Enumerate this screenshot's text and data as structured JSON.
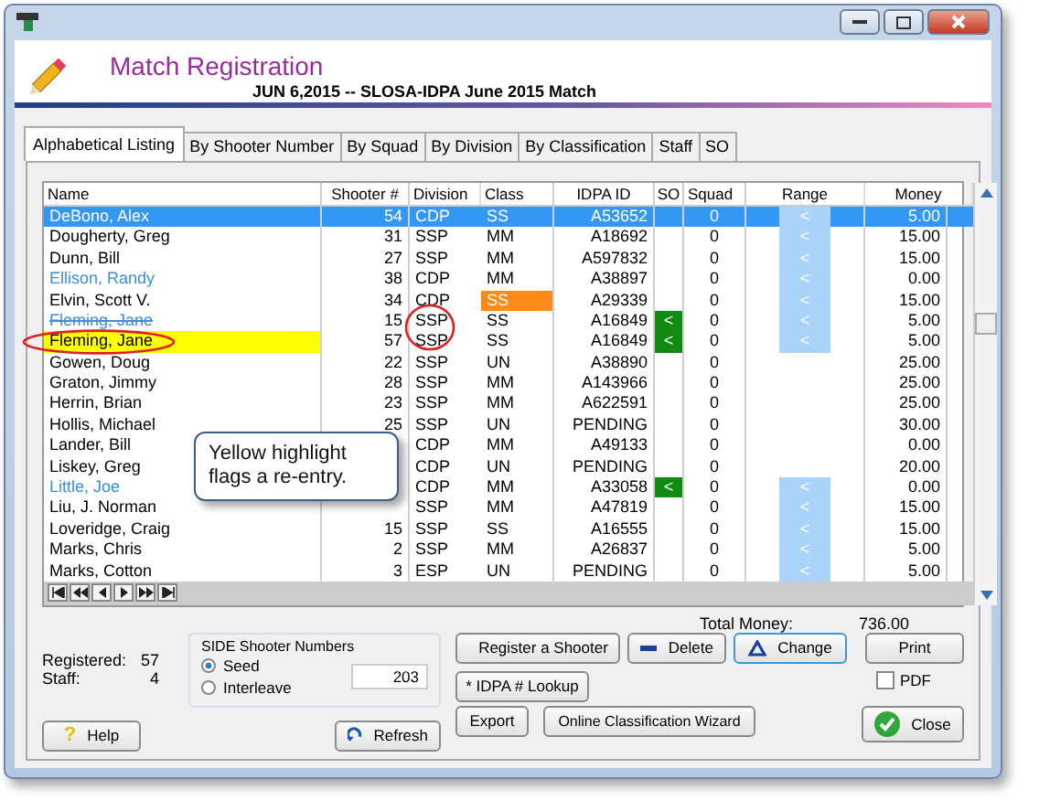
{
  "window": {
    "title": "Match Registration",
    "subtitle": "JUN  6,2015 -- SLOSA-IDPA June 2015 Match"
  },
  "tabs": [
    {
      "label": "Alphabetical Listing",
      "selected": true
    },
    {
      "label": "By Shooter Number",
      "selected": false
    },
    {
      "label": "By Squad",
      "selected": false
    },
    {
      "label": "By Division",
      "selected": false
    },
    {
      "label": "By Classification",
      "selected": false
    },
    {
      "label": "Staff",
      "selected": false
    },
    {
      "label": "SO",
      "selected": false
    }
  ],
  "table": {
    "columns": [
      "Name",
      "Shooter #",
      "Division",
      "Class",
      "IDPA ID",
      "SO",
      "Squad",
      "Range",
      "Money"
    ],
    "rows": [
      {
        "name": "DeBono, Alex",
        "number": "54",
        "division": "CDP",
        "class": "SS",
        "idpa_id": "A53652",
        "squad": "0",
        "range": "<",
        "money": "5.00",
        "selected": true
      },
      {
        "name": "Dougherty, Greg",
        "number": "31",
        "division": "SSP",
        "class": "MM",
        "idpa_id": "A18692",
        "squad": "0",
        "range": "<",
        "money": "15.00",
        "selected": false
      },
      {
        "name": "Dunn, Bill",
        "number": "27",
        "division": "SSP",
        "class": "MM",
        "idpa_id": "A597832",
        "squad": "0",
        "range": "<",
        "money": "15.00",
        "selected": false
      },
      {
        "name": "Ellison, Randy",
        "color": "#3c8de0",
        "number": "38",
        "division": "CDP",
        "class": "MM",
        "idpa_id": "A38897",
        "squad": "0",
        "range": "<",
        "money": "0.00",
        "selected": false
      },
      {
        "name": "Elvin, Scott V.",
        "number": "34",
        "division": "CDP",
        "class": "SS",
        "class_flag": true,
        "idpa_id": "A29339",
        "squad": "0",
        "range": "<",
        "money": "15.00",
        "selected": false
      },
      {
        "name": "Fleming, Jane",
        "color": "#3c8de0",
        "struck": true,
        "number": "15",
        "division": "SSP",
        "class": "SS",
        "idpa_id": "A16849",
        "so": "<",
        "squad": "0",
        "range": "<",
        "money": "5.00",
        "selected": false
      },
      {
        "name": "Fleming, Jane",
        "highlighted": true,
        "number": "57",
        "division": "SSP",
        "class": "SS",
        "idpa_id": "A16849",
        "so": "<",
        "squad": "0",
        "range": "<",
        "money": "5.00",
        "selected": false
      },
      {
        "name": "Gowen, Doug",
        "number": "22",
        "division": "SSP",
        "class": "UN",
        "idpa_id": "A38890",
        "squad": "0",
        "money": "25.00",
        "selected": false
      },
      {
        "name": "Graton, Jimmy",
        "number": "28",
        "division": "SSP",
        "class": "MM",
        "idpa_id": "A143966",
        "squad": "0",
        "money": "25.00",
        "selected": false
      },
      {
        "name": "Herrin, Brian",
        "number": "23",
        "division": "SSP",
        "class": "MM",
        "idpa_id": "A622591",
        "squad": "0",
        "money": "25.00",
        "selected": false
      },
      {
        "name": "Hollis, Michael",
        "number": "25",
        "division": "SSP",
        "class": "UN",
        "idpa_id": "PENDING",
        "squad": "0",
        "money": "30.00",
        "selected": false
      },
      {
        "name": "Lander, Bill",
        "division": "CDP",
        "class": "MM",
        "idpa_id": "A49133",
        "squad": "0",
        "money": "0.00",
        "selected": false
      },
      {
        "name": "Liskey, Greg",
        "division": "CDP",
        "class": "UN",
        "idpa_id": "PENDING",
        "squad": "0",
        "money": "20.00",
        "selected": false
      },
      {
        "name": "Little, Joe",
        "color": "#3c8de0",
        "division": "CDP",
        "class": "MM",
        "idpa_id": "A33058",
        "so": "<",
        "squad": "0",
        "range": "<",
        "money": "0.00",
        "selected": false
      },
      {
        "name": "Liu, J. Norman",
        "division": "SSP",
        "class": "MM",
        "idpa_id": "A47819",
        "squad": "0",
        "range": "<",
        "money": "15.00",
        "selected": false
      },
      {
        "name": "Loveridge, Craig",
        "number": "15",
        "division": "SSP",
        "class": "SS",
        "idpa_id": "A16555",
        "squad": "0",
        "range": "<",
        "money": "15.00",
        "selected": false
      },
      {
        "name": "Marks, Chris",
        "number": "2",
        "division": "SSP",
        "class": "MM",
        "idpa_id": "A26837",
        "squad": "0",
        "range": "<",
        "money": "5.00",
        "selected": false
      },
      {
        "name": "Marks, Cotton",
        "number": "3",
        "division": "ESP",
        "class": "UN",
        "idpa_id": "PENDING",
        "squad": "0",
        "range": "<",
        "money": "5.00",
        "selected": false
      }
    ]
  },
  "callout": "Yellow highlight flags a re-entry.",
  "totals": {
    "label": "Total Money:",
    "value": "736.00"
  },
  "counts": [
    {
      "label": "Registered:",
      "value": "57"
    },
    {
      "label": "Staff:",
      "value": "4"
    }
  ],
  "side_numbers": {
    "title": "SIDE Shooter Numbers",
    "options": [
      {
        "label": "Seed",
        "selected": true
      },
      {
        "label": "Interleave",
        "selected": false
      }
    ],
    "value": "203"
  },
  "buttons": {
    "register": "Register a Shooter",
    "delete": "Delete",
    "change": "Change",
    "print": "Print",
    "lookup": "* IDPA # Lookup",
    "help": "Help",
    "refresh": "Refresh",
    "export": "Export",
    "wizard": "Online Classification Wizard",
    "close": "Close"
  },
  "pdf": {
    "label": "PDF",
    "checked": false
  },
  "help_icon": "?"
}
